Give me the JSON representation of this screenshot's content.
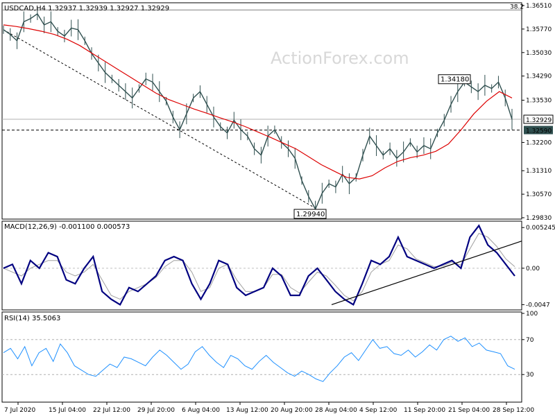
{
  "chart_data": [
    {
      "type": "line",
      "panel": "price",
      "title": "USDCAD,H4  1.32937 1.32939 1.32927 1.32929",
      "watermark": "ActionForex.com",
      "y_ticks": [
        "1.36510",
        "1.35770",
        "1.35030",
        "1.34290",
        "1.33530",
        "1.32200",
        "1.31310",
        "1.30570",
        "1.29830"
      ],
      "y_tick_values": [
        1.3651,
        1.3577,
        1.3503,
        1.3429,
        1.3353,
        1.322,
        1.3131,
        1.3057,
        1.2983
      ],
      "ylim": [
        1.2983,
        1.3651
      ],
      "fib_label": "38.2",
      "fib_level": 1.3637,
      "current_price": {
        "label": "1.32929",
        "value": 1.32929
      },
      "support": {
        "label": "1.32590",
        "value": 1.3259
      },
      "annotations": [
        {
          "label": "1.34180",
          "value": 1.3418
        },
        {
          "label": "1.29940",
          "value": 1.2994
        }
      ],
      "series": [
        {
          "key": "price",
          "color": "#2f4f4f",
          "values": [
            1.3575,
            1.356,
            1.354,
            1.36,
            1.361,
            1.3625,
            1.359,
            1.36,
            1.357,
            1.3555,
            1.358,
            1.3575,
            1.354,
            1.35,
            1.347,
            1.344,
            1.342,
            1.34,
            1.338,
            1.336,
            1.339,
            1.342,
            1.341,
            1.338,
            1.335,
            1.33,
            1.326,
            1.331,
            1.336,
            1.338,
            1.334,
            1.33,
            1.327,
            1.325,
            1.329,
            1.326,
            1.324,
            1.32,
            1.318,
            1.324,
            1.326,
            1.322,
            1.32,
            1.317,
            1.31,
            1.305,
            1.301,
            1.306,
            1.309,
            1.308,
            1.312,
            1.309,
            1.311,
            1.318,
            1.324,
            1.321,
            1.318,
            1.32,
            1.317,
            1.319,
            1.322,
            1.319,
            1.321,
            1.32,
            1.325,
            1.329,
            1.334,
            1.338,
            1.341,
            1.3395,
            1.338,
            1.34,
            1.339,
            1.341,
            1.336,
            1.3293
          ]
        },
        {
          "key": "ma",
          "color": "#dd0000",
          "values": [
            1.359,
            1.3585,
            1.3578,
            1.357,
            1.356,
            1.3545,
            1.3525,
            1.35,
            1.3475,
            1.345,
            1.3425,
            1.34,
            1.3375,
            1.3355,
            1.334,
            1.3325,
            1.3312,
            1.3298,
            1.3285,
            1.327,
            1.3253,
            1.3236,
            1.3218,
            1.32,
            1.3175,
            1.315,
            1.313,
            1.311,
            1.3105,
            1.3115,
            1.314,
            1.316,
            1.3172,
            1.318,
            1.3192,
            1.3215,
            1.326,
            1.331,
            1.335,
            1.338,
            1.336
          ]
        }
      ]
    },
    {
      "type": "line",
      "panel": "macd",
      "title": "MACD(12,26,9) -0.001100 0.000573",
      "y_ticks": [
        "0.005245",
        "0.00",
        "-0.0047"
      ],
      "y_tick_values": [
        0.005245,
        0,
        -0.0047
      ],
      "ylim": [
        -0.0052,
        0.0058
      ],
      "series": [
        {
          "key": "macd",
          "color": "#000080",
          "values": [
            0.0,
            0.0005,
            -0.002,
            0.001,
            0.0,
            0.002,
            0.0015,
            -0.0015,
            -0.002,
            0.0,
            0.0015,
            -0.003,
            -0.004,
            -0.0047,
            -0.0025,
            -0.003,
            -0.002,
            -0.001,
            0.001,
            0.0015,
            0.001,
            -0.002,
            -0.004,
            -0.002,
            0.001,
            0.0005,
            -0.0025,
            -0.0035,
            -0.003,
            -0.0025,
            0.0,
            -0.001,
            -0.0035,
            -0.0035,
            -0.001,
            0.0,
            -0.0015,
            -0.003,
            -0.004,
            -0.0047,
            -0.002,
            0.001,
            0.0005,
            0.0015,
            0.004,
            0.0015,
            0.001,
            0.0005,
            0.0,
            0.0005,
            0.001,
            0.0,
            0.004,
            0.0055,
            0.003,
            0.002,
            0.0005,
            -0.001
          ]
        },
        {
          "key": "signal",
          "color": "#a0a0a0",
          "values": [
            0.0,
            -0.0005,
            -0.001,
            0.0,
            0.0005,
            0.001,
            0.001,
            -0.0005,
            -0.001,
            -0.0005,
            0.0005,
            -0.0015,
            -0.0035,
            -0.004,
            -0.003,
            -0.0025,
            -0.002,
            -0.0012,
            0.0002,
            0.001,
            0.001,
            -0.0005,
            -0.003,
            -0.0025,
            0.0,
            0.0005,
            -0.0015,
            -0.003,
            -0.003,
            -0.0025,
            -0.0008,
            -0.0008,
            -0.0025,
            -0.0032,
            -0.0018,
            -0.0005,
            -0.001,
            -0.0022,
            -0.0035,
            -0.0042,
            -0.003,
            -0.0005,
            0.0005,
            0.001,
            0.003,
            0.0025,
            0.0012,
            0.0007,
            0.0002,
            0.0003,
            0.0008,
            0.0004,
            0.0025,
            0.0045,
            0.004,
            0.0028,
            0.0012,
            0.0002
          ]
        }
      ]
    },
    {
      "type": "line",
      "panel": "rsi",
      "title": "RSI(14) 35.5063",
      "y_ticks": [
        "100",
        "70",
        "30"
      ],
      "y_tick_values": [
        100,
        70,
        30
      ],
      "ylim": [
        0,
        100
      ],
      "series": [
        {
          "key": "rsi",
          "color": "#1e90ff",
          "values": [
            55,
            60,
            48,
            62,
            40,
            55,
            60,
            45,
            65,
            55,
            40,
            35,
            30,
            28,
            35,
            42,
            38,
            50,
            48,
            44,
            40,
            50,
            58,
            52,
            44,
            36,
            42,
            56,
            62,
            52,
            44,
            38,
            52,
            48,
            40,
            36,
            45,
            52,
            44,
            38,
            32,
            28,
            34,
            30,
            25,
            22,
            32,
            40,
            50,
            55,
            46,
            58,
            70,
            60,
            62,
            54,
            52,
            58,
            50,
            56,
            64,
            58,
            70,
            74,
            68,
            72,
            62,
            66,
            58,
            56,
            54,
            40,
            36
          ]
        }
      ]
    }
  ],
  "x_axis": {
    "labels": [
      "7 Jul 2020",
      "15 Jul 04:00",
      "22 Jul 12:00",
      "29 Jul 20:00",
      "6 Aug 04:00",
      "13 Aug 12:00",
      "20 Aug 20:00",
      "28 Aug 04:00",
      "4 Sep 12:00",
      "11 Sep 20:00",
      "21 Sep 04:00",
      "28 Sep 12:00"
    ]
  }
}
